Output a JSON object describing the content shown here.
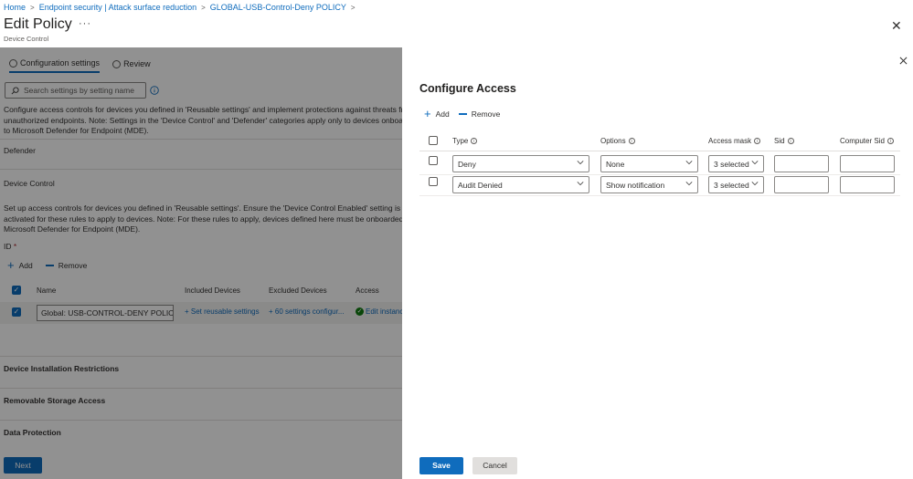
{
  "breadcrumb": [
    "Home",
    "Endpoint security | Attack surface reduction",
    "GLOBAL-USB-Control-Deny POLICY"
  ],
  "header": {
    "title": "Edit Policy",
    "subtitle": "Device Control",
    "more": "···",
    "close": "✕"
  },
  "tabs": [
    {
      "label": "Configuration settings",
      "active": true
    },
    {
      "label": "Review",
      "active": false
    }
  ],
  "search": {
    "placeholder": "Search settings by setting name"
  },
  "left": {
    "intro": "Configure access controls for devices you defined in 'Reusable settings' and implement protections against threats from unauthorized endpoints. Note: Settings in the 'Device Control' and 'Defender' categories apply only to devices onboarded to Microsoft Defender for Endpoint (MDE).",
    "defender": "Defender",
    "device_control": "Device Control",
    "dc_description": "Set up access controls for devices you defined in 'Reusable settings'. Ensure the 'Device Control Enabled' setting is activated for these rules to apply to devices. Note: For these rules to apply, devices defined here must be onboarded to Microsoft Defender for Endpoint (MDE).",
    "id_label": "ID",
    "add": "Add",
    "remove": "Remove",
    "columns": [
      "Name",
      "Included Devices",
      "Excluded Devices",
      "Access"
    ],
    "row": {
      "name": "Global: USB-CONTROL-DENY POLICY",
      "included": "+ Set reusable settings",
      "excluded": "+ 60 settings configur...",
      "access": "Edit instanc"
    },
    "sections": [
      "Device Installation Restrictions",
      "Removable Storage Access",
      "Data Protection"
    ],
    "next": "Next"
  },
  "panel": {
    "title": "Configure Access",
    "add": "Add",
    "remove": "Remove",
    "columns": [
      "Type",
      "Options",
      "Access mask",
      "Sid",
      "Computer Sid"
    ],
    "rows": [
      {
        "type": "Deny",
        "options": "None",
        "access_mask": "3 selected",
        "sid": "",
        "computer_sid": ""
      },
      {
        "type": "Audit Denied",
        "options": "Show notification",
        "access_mask": "3 selected",
        "sid": "",
        "computer_sid": ""
      }
    ],
    "save": "Save",
    "cancel": "Cancel"
  },
  "colors": {
    "accent": "#0f6cbd",
    "success": "#107c10",
    "required": "#a4262c"
  }
}
